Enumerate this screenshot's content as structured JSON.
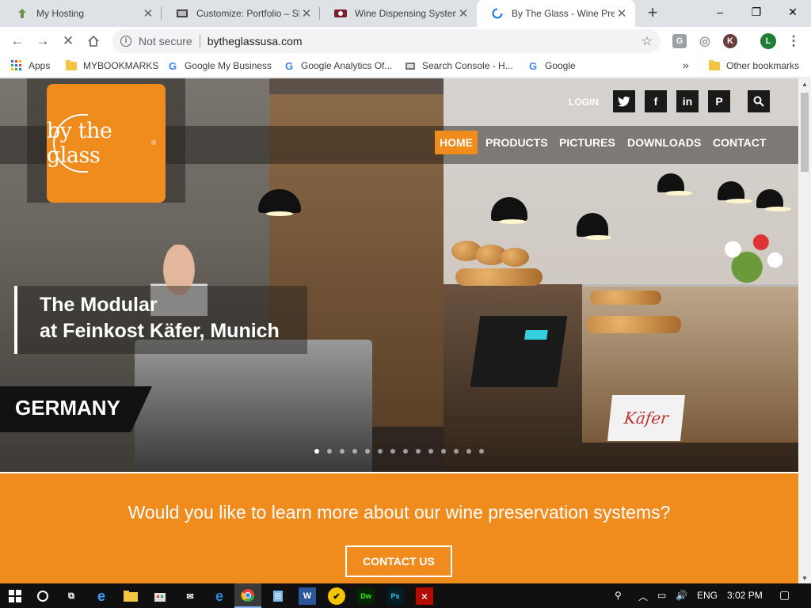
{
  "browser": {
    "tabs": [
      {
        "title": "My Hosting",
        "favicon": "hosting-icon",
        "active": false
      },
      {
        "title": "Customize: Portfolio – Sk",
        "favicon": "wordpress-icon",
        "active": false
      },
      {
        "title": "Wine Dispensing System",
        "favicon": "site-icon",
        "active": false
      },
      {
        "title": "By The Glass - Wine Pres",
        "favicon": "loading-spinner-icon",
        "active": true
      }
    ],
    "new_tab": "+",
    "window_controls": {
      "minimize": "–",
      "restore": "❐",
      "close": "✕"
    },
    "address": {
      "security_label": "Not secure",
      "url": "bytheglassusa.com",
      "star": "☆"
    },
    "extensions": [
      {
        "name": "g-extension-icon",
        "label": "G",
        "color": "#9aa0a6"
      },
      {
        "name": "headphones-extension-icon",
        "label": "◎",
        "color": "#9aa0a6"
      },
      {
        "name": "k-extension-icon",
        "label": "K",
        "color": "#6b3e3e"
      },
      {
        "name": "profile-avatar-icon",
        "label": "L",
        "color": "#1e7e34"
      }
    ],
    "bookmarks": [
      {
        "label": "Apps",
        "icon": "apps-grid-icon"
      },
      {
        "label": "MYBOOKMARKS",
        "icon": "folder-icon"
      },
      {
        "label": "Google My Business",
        "icon": "google-icon"
      },
      {
        "label": "Google Analytics Of...",
        "icon": "google-icon"
      },
      {
        "label": "Search Console - H...",
        "icon": "search-console-icon"
      },
      {
        "label": "Google",
        "icon": "google-icon"
      }
    ],
    "bookmarks_overflow": "»",
    "other_bookmarks": "Other bookmarks"
  },
  "site": {
    "logo_text": "by the glass",
    "logo_reg": "®",
    "login": "LOGIN",
    "social": [
      {
        "name": "twitter-icon",
        "glyph": "🐦"
      },
      {
        "name": "facebook-icon",
        "glyph": "f"
      },
      {
        "name": "linkedin-icon",
        "glyph": "in"
      },
      {
        "name": "pinterest-icon",
        "glyph": "P"
      },
      {
        "name": "search-icon",
        "glyph": "⌕"
      }
    ],
    "menu": [
      "HOME",
      "PRODUCTS",
      "PICTURES",
      "DOWNLOADS",
      "CONTACT"
    ],
    "active_menu": "HOME",
    "slide": {
      "caption_line1": "The Modular",
      "caption_line2": "at Feinkost Käfer, Munich",
      "country": "GERMANY",
      "sign": "Käfer",
      "slide_count": 14,
      "active_slide": 0
    },
    "cta": {
      "question": "Would you like to learn more about our wine preservation systems?",
      "button": "CONTACT US"
    },
    "colors": {
      "brand_orange": "#f08b1d"
    }
  },
  "taskbar": {
    "apps": [
      {
        "name": "windows-start-icon",
        "glyph": "⊞"
      },
      {
        "name": "cortana-search-icon",
        "glyph": "○"
      },
      {
        "name": "task-view-icon",
        "glyph": "⧉"
      },
      {
        "name": "edge-icon",
        "glyph": "e"
      },
      {
        "name": "file-explorer-icon",
        "glyph": "▭"
      },
      {
        "name": "store-icon",
        "glyph": "⊡"
      },
      {
        "name": "mail-icon",
        "glyph": "✉"
      },
      {
        "name": "internet-explorer-icon",
        "glyph": "e"
      },
      {
        "name": "chrome-icon",
        "glyph": "◉"
      },
      {
        "name": "notepad-icon",
        "glyph": "▤"
      },
      {
        "name": "word-icon",
        "glyph": "W"
      },
      {
        "name": "norton-icon",
        "glyph": "✔"
      },
      {
        "name": "dreamweaver-icon",
        "glyph": "Dw"
      },
      {
        "name": "photoshop-icon",
        "glyph": "Ps"
      },
      {
        "name": "acrobat-icon",
        "glyph": "⨯"
      }
    ],
    "language": "ENG",
    "time": "3:02 PM"
  }
}
